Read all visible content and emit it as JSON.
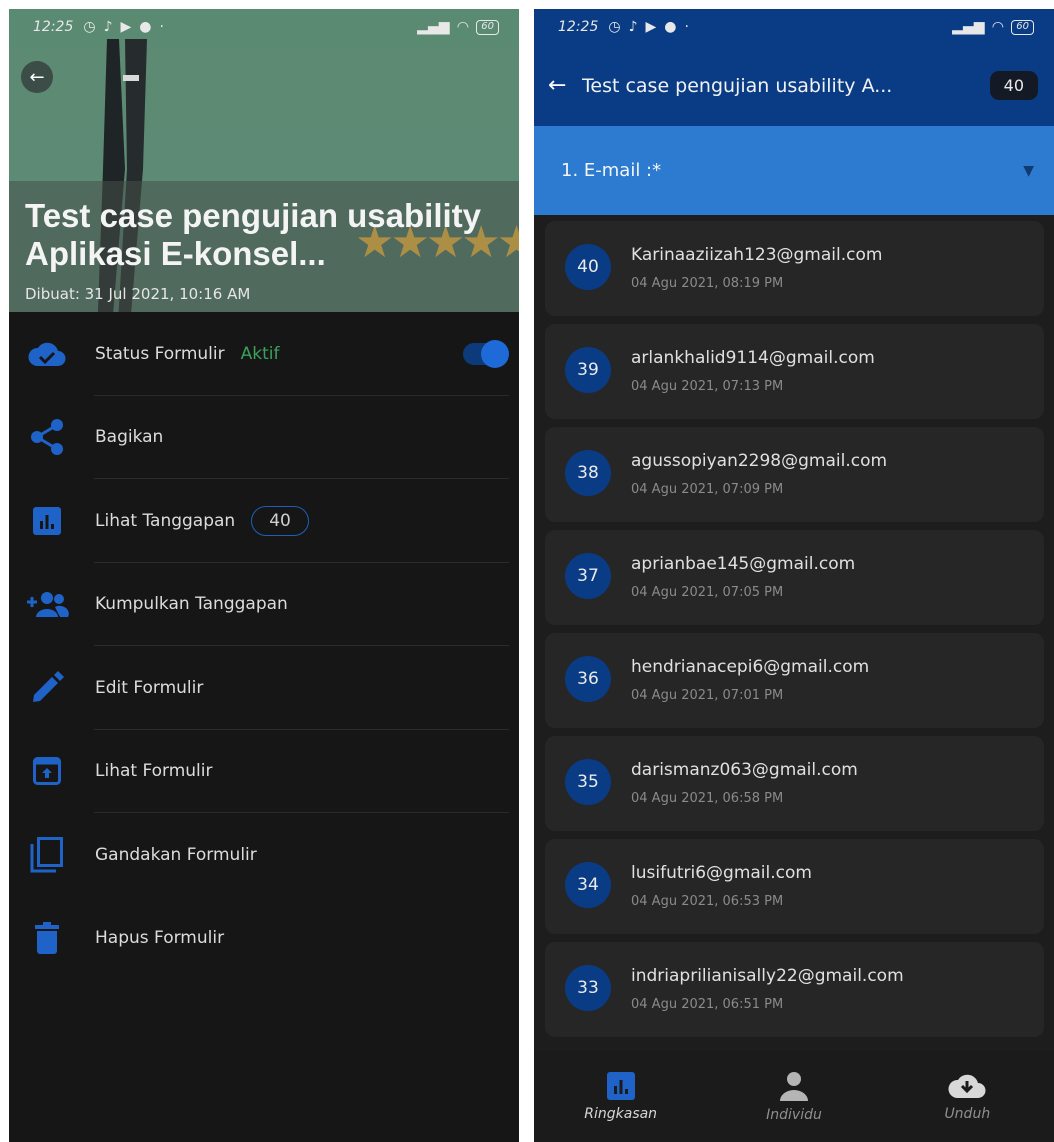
{
  "status_bar": {
    "time": "12:25",
    "battery": "60"
  },
  "left": {
    "title": "Test case pengujian usability Aplikasi E-konsel...",
    "created": "Dibuat: 31 Jul 2021, 10:16 AM",
    "menu": {
      "status_label": "Status Formulir",
      "status_value": "Aktif",
      "share": "Bagikan",
      "view_responses": "Lihat Tanggapan",
      "responses_count": "40",
      "collect": "Kumpulkan Tanggapan",
      "edit": "Edit Formulir",
      "view_form": "Lihat Formulir",
      "duplicate": "Gandakan Formulir",
      "delete": "Hapus Formulir"
    },
    "colors": {
      "accent": "#1e6ad8",
      "active": "#3aa15d"
    }
  },
  "right": {
    "title": "Test case pengujian usability A...",
    "count": "40",
    "question_filter": "1. E-mail :*",
    "responses": [
      {
        "num": "40",
        "email": "Karinaaziizah123@gmail.com",
        "date": "04 Agu 2021, 08:19 PM"
      },
      {
        "num": "39",
        "email": "arlankhalid9114@gmail.com",
        "date": "04 Agu 2021, 07:13 PM"
      },
      {
        "num": "38",
        "email": "agussopiyan2298@gmail.com",
        "date": "04 Agu 2021, 07:09 PM"
      },
      {
        "num": "37",
        "email": "aprianbae145@gmail.com",
        "date": "04 Agu 2021, 07:05 PM"
      },
      {
        "num": "36",
        "email": "hendrianacepi6@gmail.com",
        "date": "04 Agu 2021, 07:01 PM"
      },
      {
        "num": "35",
        "email": "darismanz063@gmail.com",
        "date": "04 Agu 2021, 06:58 PM"
      },
      {
        "num": "34",
        "email": "lusifutri6@gmail.com",
        "date": "04 Agu 2021, 06:53 PM"
      },
      {
        "num": "33",
        "email": "indriaprilianisally22@gmail.com",
        "date": "04 Agu 2021, 06:51 PM"
      }
    ],
    "nav": {
      "summary": "Ringkasan",
      "individual": "Individu",
      "download": "Unduh"
    }
  }
}
